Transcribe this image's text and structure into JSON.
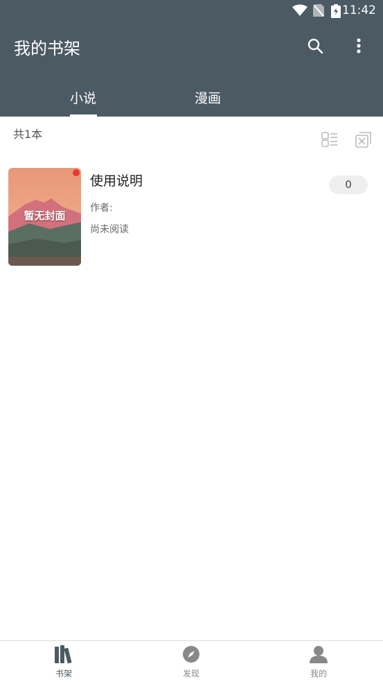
{
  "status_bar": {
    "time": "11:42",
    "icons": [
      "wifi-icon",
      "no-sim-icon",
      "battery-charging-icon"
    ]
  },
  "app_bar": {
    "title": "我的书架",
    "actions": [
      "search-icon",
      "more-vert-icon"
    ]
  },
  "tabs": [
    {
      "label": "小说",
      "selected": true
    },
    {
      "label": "漫画",
      "selected": false
    }
  ],
  "shelf": {
    "count_text": "共1本",
    "tools": [
      "list-layout-icon",
      "batch-manage-icon"
    ]
  },
  "books": [
    {
      "cover_text": "暂无封面",
      "title": "使用说明",
      "author": "作者:",
      "progress": "尚未阅读",
      "badge": "0",
      "has_update_dot": true
    }
  ],
  "bottom_nav": [
    {
      "label": "书架",
      "icon": "bookshelf-icon",
      "active": true
    },
    {
      "label": "发现",
      "icon": "compass-icon",
      "active": false
    },
    {
      "label": "我的",
      "icon": "person-icon",
      "active": false
    }
  ],
  "colors": {
    "primary": "#4b5a63",
    "accent_dot": "#e53935",
    "nav_active": "#4b5a63",
    "nav_inactive": "#888888"
  }
}
